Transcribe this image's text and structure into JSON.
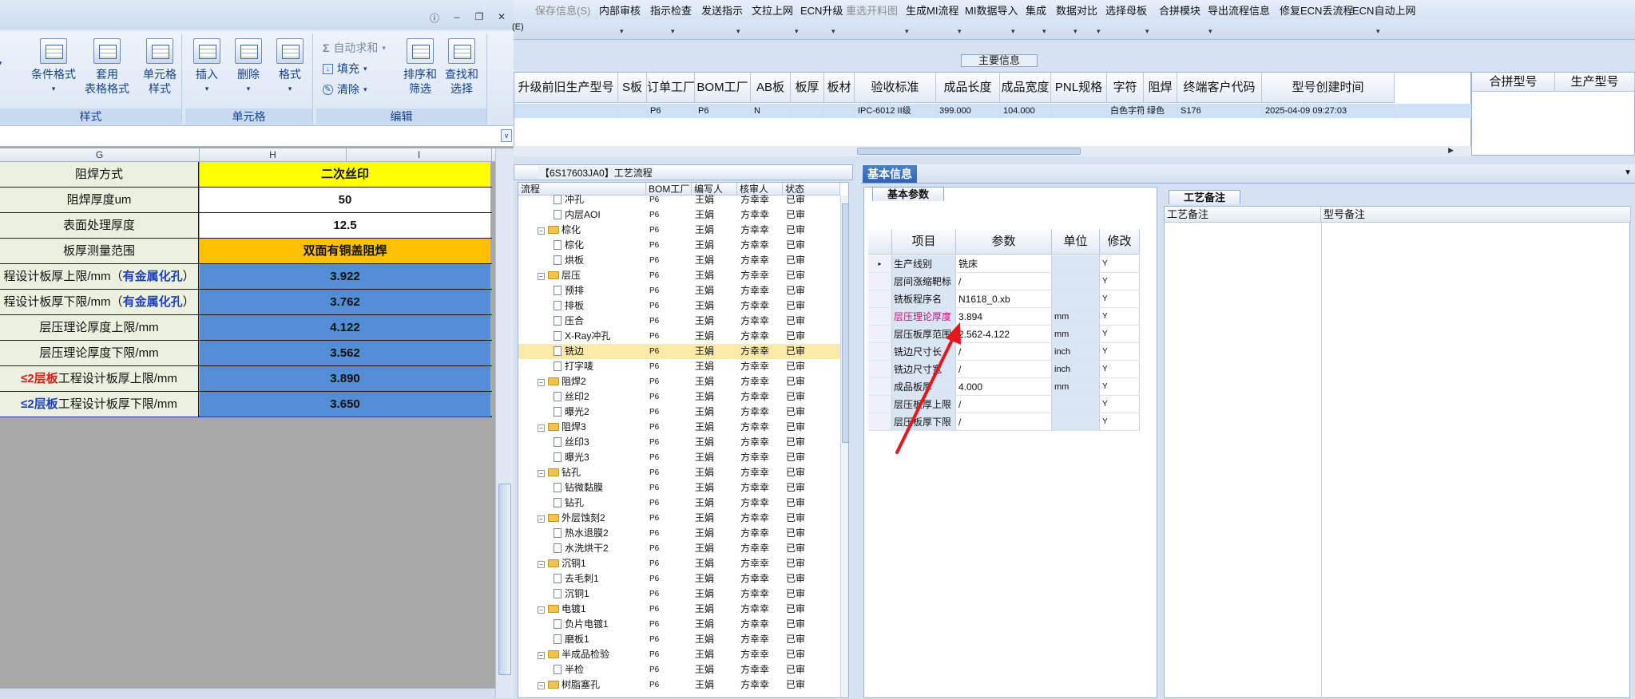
{
  "excel": {
    "ribbon": {
      "style_group": {
        "label": "样式",
        "cond_format": "条件格式",
        "table_format_1": "套用",
        "table_format_2": "表格格式",
        "cell_style_1": "单元格",
        "cell_style_2": "样式"
      },
      "cells_group": {
        "label": "单元格",
        "insert": "插入",
        "delete": "删除",
        "format": "格式"
      },
      "edit_group": {
        "label": "编辑",
        "autosum": "自动求和",
        "fill": "填充",
        "clear": "清除",
        "sort_1": "排序和",
        "sort_2": "筛选",
        "find_1": "查找和",
        "find_2": "选择"
      }
    },
    "columns": [
      "G",
      "H",
      "I"
    ],
    "rows": [
      {
        "label": "阻焊方式",
        "value": "二次丝印",
        "bg": "#ffff00"
      },
      {
        "label": "阻焊厚度um",
        "value": "50",
        "bg": "#ffffff"
      },
      {
        "label": "表面处理厚度",
        "value": "12.5",
        "bg": "#ffffff"
      },
      {
        "label": "板厚测量范围",
        "value": "双面有铜盖阻焊",
        "bg": "#ffc000"
      },
      {
        "label_pre": "程设计板厚上限/mm（",
        "label_em": "有金属化孔",
        "label_post": "）",
        "value": "3.922",
        "bg": "#538dd5"
      },
      {
        "label_pre": "程设计板厚下限/mm（",
        "label_em": "有金属化孔",
        "label_post": "）",
        "value": "3.762",
        "bg": "#538dd5"
      },
      {
        "label": "层压理论厚度上限/mm",
        "value": "4.122",
        "bg": "#538dd5"
      },
      {
        "label": "层压理论厚度下限/mm",
        "value": "3.562",
        "bg": "#538dd5"
      },
      {
        "label_red": "≤2层板",
        "label_post": "工程设计板厚上限/mm",
        "value": "3.890",
        "bg": "#538dd5"
      },
      {
        "label_blue": "≤2层板",
        "label_post": "工程设计板厚下限/mm",
        "value": "3.650",
        "bg": "#538dd5"
      }
    ]
  },
  "app": {
    "menu_row1": [
      {
        "label": "保存信息(S)",
        "disabled": true
      },
      {
        "label": "内部审核"
      },
      {
        "label": "指示检查"
      },
      {
        "label": "发送指示"
      },
      {
        "label": "文拉上网"
      },
      {
        "label": "ECN升级"
      },
      {
        "label": "重选开料图",
        "disabled": true
      },
      {
        "label": "生成MI流程"
      },
      {
        "label": "MI数据导入"
      },
      {
        "label": "集成"
      },
      {
        "label": "数据对比"
      },
      {
        "label": "选择母板"
      },
      {
        "label": "合拼模块"
      },
      {
        "label": "导出流程信息"
      },
      {
        "label": "修复ECN丢流程"
      },
      {
        "label": "ECN自动上网"
      }
    ],
    "menu_fragment": "(E)",
    "main_info_label": "主要信息",
    "top_table": {
      "headers": [
        "升级前旧生产型号",
        "S板",
        "订单工厂",
        "BOM工厂",
        "AB板",
        "板厚",
        "板材",
        "验收标准",
        "成品长度",
        "成品宽度",
        "PNL规格",
        "字符",
        "阻焊",
        "终端客户代码",
        "型号创建时间"
      ],
      "row": [
        "",
        "",
        "P6",
        "P6",
        "N",
        "",
        "",
        "IPC-6012 II级",
        "399.000",
        "104.000",
        "",
        "白色字符",
        "绿色",
        "S176",
        "2025-04-09 09:27:03"
      ],
      "right_headers": [
        "合拼型号",
        "生产型号"
      ]
    },
    "tree": {
      "title": "【6S17603JA0】工艺流程",
      "headers": [
        "流程",
        "BOM工厂",
        "编写人",
        "核审人",
        "状态"
      ],
      "rows": [
        {
          "level": 1,
          "type": "doc",
          "name": "冲孔",
          "factory": "P6",
          "writer": "王娟",
          "reviewer": "方幸幸",
          "status": "已审核"
        },
        {
          "level": 1,
          "type": "doc",
          "name": "内层AOI",
          "factory": "P6",
          "writer": "王娟",
          "reviewer": "方幸幸",
          "status": "已审核"
        },
        {
          "level": 0,
          "type": "folder",
          "name": "棕化",
          "factory": "P6",
          "writer": "王娟",
          "reviewer": "方幸幸",
          "status": "已审核"
        },
        {
          "level": 1,
          "type": "doc",
          "name": "棕化",
          "factory": "P6",
          "writer": "王娟",
          "reviewer": "方幸幸",
          "status": "已审核"
        },
        {
          "level": 1,
          "type": "doc",
          "name": "烘板",
          "factory": "P6",
          "writer": "王娟",
          "reviewer": "方幸幸",
          "status": "已审核"
        },
        {
          "level": 0,
          "type": "folder",
          "name": "层压",
          "factory": "P6",
          "writer": "王娟",
          "reviewer": "方幸幸",
          "status": "已审核"
        },
        {
          "level": 1,
          "type": "doc",
          "name": "预排",
          "factory": "P6",
          "writer": "王娟",
          "reviewer": "方幸幸",
          "status": "已审核"
        },
        {
          "level": 1,
          "type": "doc",
          "name": "排板",
          "factory": "P6",
          "writer": "王娟",
          "reviewer": "方幸幸",
          "status": "已审核"
        },
        {
          "level": 1,
          "type": "doc",
          "name": "压合",
          "factory": "P6",
          "writer": "王娟",
          "reviewer": "方幸幸",
          "status": "已审核"
        },
        {
          "level": 1,
          "type": "doc",
          "name": "X-Ray冲孔",
          "factory": "P6",
          "writer": "王娟",
          "reviewer": "方幸幸",
          "status": "已审核"
        },
        {
          "level": 1,
          "type": "doc",
          "name": "铣边",
          "factory": "P6",
          "writer": "王娟",
          "reviewer": "方幸幸",
          "status": "已审核",
          "selected": true
        },
        {
          "level": 1,
          "type": "doc",
          "name": "打字唛",
          "factory": "P6",
          "writer": "王娟",
          "reviewer": "方幸幸",
          "status": "已审核"
        },
        {
          "level": 0,
          "type": "folder",
          "name": "阻焊2",
          "factory": "P6",
          "writer": "王娟",
          "reviewer": "方幸幸",
          "status": "已审核"
        },
        {
          "level": 1,
          "type": "doc",
          "name": "丝印2",
          "factory": "P6",
          "writer": "王娟",
          "reviewer": "方幸幸",
          "status": "已审核"
        },
        {
          "level": 1,
          "type": "doc",
          "name": "曝光2",
          "factory": "P6",
          "writer": "王娟",
          "reviewer": "方幸幸",
          "status": "已审核"
        },
        {
          "level": 0,
          "type": "folder",
          "name": "阻焊3",
          "factory": "P6",
          "writer": "王娟",
          "reviewer": "方幸幸",
          "status": "已审核"
        },
        {
          "level": 1,
          "type": "doc",
          "name": "丝印3",
          "factory": "P6",
          "writer": "王娟",
          "reviewer": "方幸幸",
          "status": "已审核"
        },
        {
          "level": 1,
          "type": "doc",
          "name": "曝光3",
          "factory": "P6",
          "writer": "王娟",
          "reviewer": "方幸幸",
          "status": "已审核"
        },
        {
          "level": 0,
          "type": "folder",
          "name": "钻孔",
          "factory": "P6",
          "writer": "王娟",
          "reviewer": "方幸幸",
          "status": "已审核"
        },
        {
          "level": 1,
          "type": "doc",
          "name": "钻微黏膜",
          "factory": "P6",
          "writer": "王娟",
          "reviewer": "方幸幸",
          "status": "已审核"
        },
        {
          "level": 1,
          "type": "doc",
          "name": "钻孔",
          "factory": "P6",
          "writer": "王娟",
          "reviewer": "方幸幸",
          "status": "已审核"
        },
        {
          "level": 0,
          "type": "folder",
          "name": "外层蚀刻2",
          "factory": "P6",
          "writer": "王娟",
          "reviewer": "方幸幸",
          "status": "已审核"
        },
        {
          "level": 1,
          "type": "doc",
          "name": "热水退膜2",
          "factory": "P6",
          "writer": "王娟",
          "reviewer": "方幸幸",
          "status": "已审核"
        },
        {
          "level": 1,
          "type": "doc",
          "name": "水洗烘干2",
          "factory": "P6",
          "writer": "王娟",
          "reviewer": "方幸幸",
          "status": "已审核"
        },
        {
          "level": 0,
          "type": "folder",
          "name": "沉铜1",
          "factory": "P6",
          "writer": "王娟",
          "reviewer": "方幸幸",
          "status": "已审核"
        },
        {
          "level": 1,
          "type": "doc",
          "name": "去毛刺1",
          "factory": "P6",
          "writer": "王娟",
          "reviewer": "方幸幸",
          "status": "已审核"
        },
        {
          "level": 1,
          "type": "doc",
          "name": "沉铜1",
          "factory": "P6",
          "writer": "王娟",
          "reviewer": "方幸幸",
          "status": "已审核"
        },
        {
          "level": 0,
          "type": "folder",
          "name": "电镀1",
          "factory": "P6",
          "writer": "王娟",
          "reviewer": "方幸幸",
          "status": "已审核"
        },
        {
          "level": 1,
          "type": "doc",
          "name": "负片电镀1",
          "factory": "P6",
          "writer": "王娟",
          "reviewer": "方幸幸",
          "status": "已审核"
        },
        {
          "level": 1,
          "type": "doc",
          "name": "磨板1",
          "factory": "P6",
          "writer": "王娟",
          "reviewer": "方幸幸",
          "status": "已审核"
        },
        {
          "level": 0,
          "type": "folder",
          "name": "半成品检验",
          "factory": "P6",
          "writer": "王娟",
          "reviewer": "方幸幸",
          "status": "已审核"
        },
        {
          "level": 1,
          "type": "doc",
          "name": "半检",
          "factory": "P6",
          "writer": "王娟",
          "reviewer": "方幸幸",
          "status": "已审核"
        },
        {
          "level": 0,
          "type": "folder",
          "name": "树脂塞孔",
          "factory": "P6",
          "writer": "王娟",
          "reviewer": "方幸幸",
          "status": "已审核"
        }
      ]
    },
    "basic_info": {
      "tab": "基本信息",
      "param_tab": "基本参数",
      "headers": [
        "项目",
        "参数",
        "单位",
        "修改"
      ],
      "rows": [
        {
          "k": "生产线别",
          "v": "铣床",
          "u": "",
          "m": "Y",
          "current": true
        },
        {
          "k": "层间涨缩靶标",
          "v": "/",
          "u": "",
          "m": "Y"
        },
        {
          "k": "铣板程序名",
          "v": "N1618_0.xb",
          "u": "",
          "m": "Y"
        },
        {
          "k": "层压理论厚度",
          "v": "3.894",
          "u": "mm",
          "m": "Y",
          "highlight": true
        },
        {
          "k": "层压板厚范围",
          "v": "2.562-4.122",
          "u": "mm",
          "m": "Y"
        },
        {
          "k": "铣边尺寸长",
          "v": "/",
          "u": "inch",
          "m": "Y"
        },
        {
          "k": "铣边尺寸宽",
          "v": "/",
          "u": "inch",
          "m": "Y"
        },
        {
          "k": "成品板厚",
          "v": "4.000",
          "u": "mm",
          "m": "Y"
        },
        {
          "k": "层压板厚上限",
          "v": "/",
          "u": "",
          "m": "Y"
        },
        {
          "k": "层压板厚下限",
          "v": "/",
          "u": "",
          "m": "Y"
        }
      ],
      "remark_tab": "工艺备注",
      "remark_headers": [
        "工艺备注",
        "型号备注"
      ]
    },
    "colors": {
      "annotation_arrow": "#e8141c",
      "sheet_blue": "#538dd5"
    }
  }
}
